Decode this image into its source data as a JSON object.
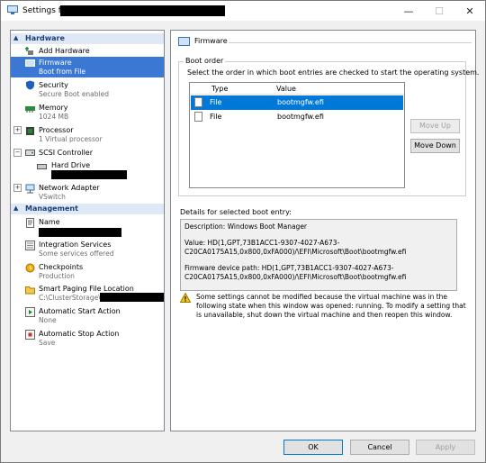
{
  "window": {
    "title": "Settings for",
    "minimize": "—",
    "maximize": "☐",
    "close": "✕"
  },
  "left": {
    "hardware_header": "Hardware",
    "management_header": "Management",
    "hardware": [
      {
        "name": "Add Hardware",
        "sub": ""
      },
      {
        "name": "Firmware",
        "sub": "Boot from File"
      },
      {
        "name": "Security",
        "sub": "Secure Boot enabled"
      },
      {
        "name": "Memory",
        "sub": "1024 MB"
      },
      {
        "name": "Processor",
        "sub": "1 Virtual processor"
      },
      {
        "name": "SCSI Controller",
        "sub": ""
      },
      {
        "name": "Hard Drive",
        "sub": ""
      },
      {
        "name": "Network Adapter",
        "sub": "VSwitch"
      }
    ],
    "management": [
      {
        "name": "Name",
        "sub": ""
      },
      {
        "name": "Integration Services",
        "sub": "Some services offered"
      },
      {
        "name": "Checkpoints",
        "sub": "Production"
      },
      {
        "name": "Smart Paging File Location",
        "sub": "C:\\ClusterStorage\\VM"
      },
      {
        "name": "Automatic Start Action",
        "sub": "None"
      },
      {
        "name": "Automatic Stop Action",
        "sub": "Save"
      }
    ]
  },
  "firmware": {
    "title": "Firmware",
    "group_label": "Boot order",
    "instructions": "Select the order in which boot entries are checked to start the operating system.",
    "col_type": "Type",
    "col_value": "Value",
    "entries": [
      {
        "type": "File",
        "value": "bootmgfw.efi"
      },
      {
        "type": "File",
        "value": "bootmgfw.efi"
      }
    ],
    "move_up": "Move Up",
    "move_down": "Move Down",
    "details_label": "Details for selected boot entry:",
    "details": [
      "Description: Windows Boot Manager",
      "Value: HD(1,GPT,73B1ACC1-9307-4027-A673-C20CA0175A15,0x800,0xFA000)/\\EFI\\Microsoft\\Boot\\bootmgfw.efi",
      "Firmware device path: HD(1,GPT,73B1ACC1-9307-4027-A673-C20CA0175A15,0x800,0xFA000)/\\EFI\\Microsoft\\Boot\\bootmgfw.efi"
    ],
    "warning": "Some settings cannot be modified because the virtual machine was in the following state when this window was opened: running. To modify a setting that is unavailable, shut down the virtual machine and then reopen this window."
  },
  "buttons": {
    "ok": "OK",
    "cancel": "Cancel",
    "apply": "Apply"
  }
}
